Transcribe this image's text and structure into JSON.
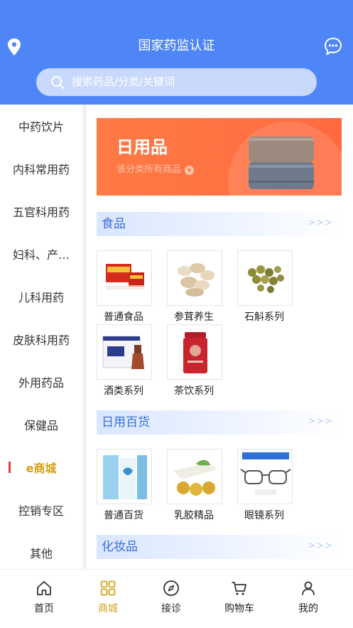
{
  "header": {
    "title": "国家药监认证",
    "search_placeholder": "搜索药品/分类/关键词",
    "location_icon": "location-pin-icon",
    "message_icon": "chat-bubble-icon"
  },
  "sidebar": {
    "items": [
      {
        "label": "中药饮片"
      },
      {
        "label": "内科常用药"
      },
      {
        "label": "五官科用药"
      },
      {
        "label": "妇科、产…"
      },
      {
        "label": "儿科用药"
      },
      {
        "label": "皮肤科用药"
      },
      {
        "label": "外用药品"
      },
      {
        "label": "保健品"
      },
      {
        "label": "e商城"
      },
      {
        "label": "控销专区"
      },
      {
        "label": "其他"
      }
    ],
    "active_index": 8
  },
  "banner": {
    "title": "日用品",
    "subtitle": "该分类所有商品"
  },
  "sections": [
    {
      "title": "食品",
      "more": ">>>",
      "products": [
        {
          "name": "普通食品"
        },
        {
          "name": "参茸养生"
        },
        {
          "name": "石斛系列"
        },
        {
          "name": "酒类系列"
        },
        {
          "name": "茶饮系列"
        }
      ]
    },
    {
      "title": "日用百货",
      "more": ">>>",
      "products": [
        {
          "name": "普通百货"
        },
        {
          "name": "乳胶精品"
        },
        {
          "name": "眼镜系列"
        }
      ]
    },
    {
      "title": "化妆品",
      "more": ">>>",
      "products": []
    }
  ],
  "bottom_nav": {
    "items": [
      {
        "label": "首页",
        "icon": "home-icon"
      },
      {
        "label": "商城",
        "icon": "grid-icon"
      },
      {
        "label": "接诊",
        "icon": "compass-icon"
      },
      {
        "label": "购物车",
        "icon": "cart-icon"
      },
      {
        "label": "我的",
        "icon": "user-icon"
      }
    ],
    "active_index": 1
  },
  "colors": {
    "brand_blue": "#4f86f7",
    "active_gold": "#d4a017",
    "banner_orange": "#ff6a40",
    "indicator_red": "#e53935"
  }
}
